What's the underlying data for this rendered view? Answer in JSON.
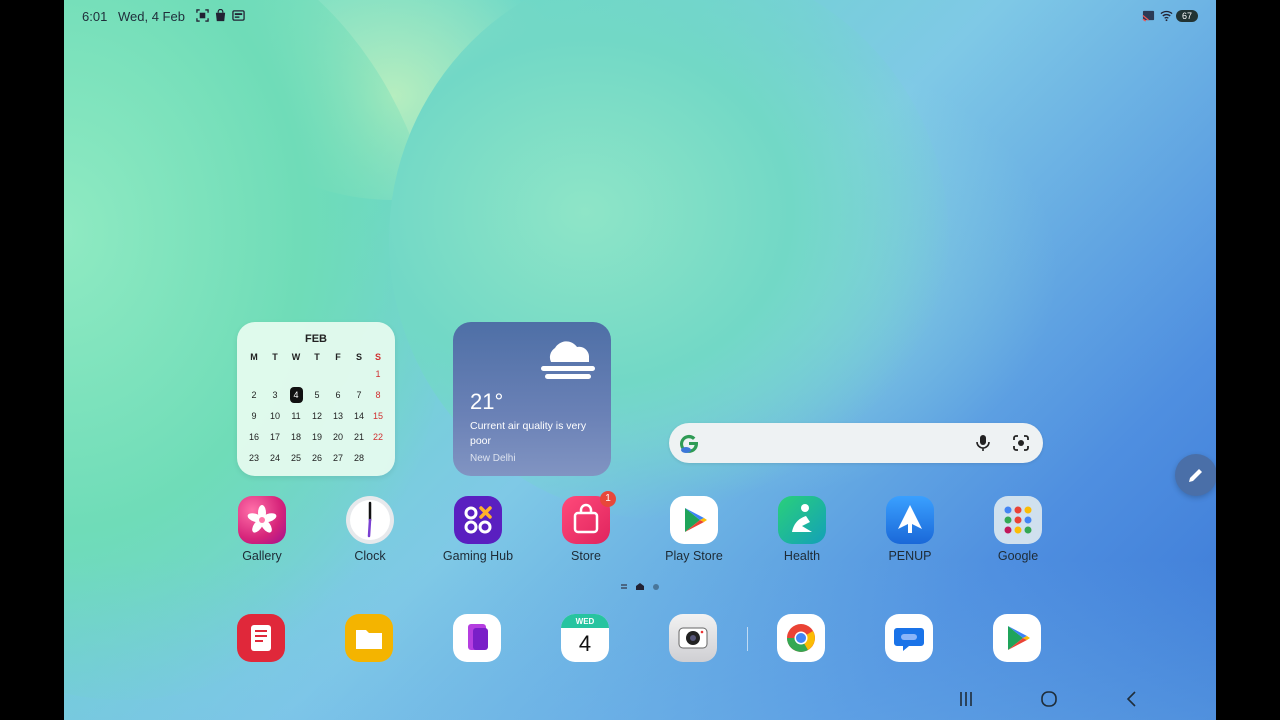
{
  "status_bar": {
    "time": "6:01",
    "date": "Wed, 4 Feb",
    "battery": "67"
  },
  "calendar": {
    "month": "FEB",
    "weekdays": [
      "M",
      "T",
      "W",
      "T",
      "F",
      "S",
      "S"
    ],
    "weeks": [
      [
        "",
        "",
        "",
        "",
        "",
        "",
        "1"
      ],
      [
        "2",
        "3",
        "4",
        "5",
        "6",
        "7",
        "8"
      ],
      [
        "9",
        "10",
        "11",
        "12",
        "13",
        "14",
        "15"
      ],
      [
        "16",
        "17",
        "18",
        "19",
        "20",
        "21",
        "22"
      ],
      [
        "23",
        "24",
        "25",
        "26",
        "27",
        "28",
        ""
      ]
    ],
    "today": "4"
  },
  "weather": {
    "temperature": "21°",
    "description": "Current air quality is very poor",
    "location": "New Delhi",
    "icon": "fog-icon"
  },
  "search": {
    "icons": [
      "google-g-icon",
      "mic-icon",
      "lens-icon"
    ]
  },
  "apps": [
    {
      "label": "Gallery",
      "icon": "gallery-icon"
    },
    {
      "label": "Clock",
      "icon": "clock-icon"
    },
    {
      "label": "Gaming Hub",
      "icon": "gaming-hub-icon"
    },
    {
      "label": "Store",
      "icon": "store-icon",
      "badge": "1"
    },
    {
      "label": "Play Store",
      "icon": "play-store-icon"
    },
    {
      "label": "Health",
      "icon": "health-icon"
    },
    {
      "label": "PENUP",
      "icon": "penup-icon"
    },
    {
      "label": "Google",
      "icon": "google-folder-icon"
    }
  ],
  "dock": [
    {
      "icon": "notes-icon"
    },
    {
      "icon": "my-files-icon"
    },
    {
      "icon": "bookmarks-icon"
    },
    {
      "icon": "calendar-icon",
      "day": "WED",
      "date": "4"
    },
    {
      "icon": "camera-icon"
    },
    {
      "icon": "chrome-icon"
    },
    {
      "icon": "messages-icon"
    },
    {
      "icon": "play-store-icon"
    }
  ],
  "nav": [
    "recents-icon",
    "home-icon",
    "back-icon"
  ],
  "colors": {
    "accent": "#4a6fa8",
    "badge": "#e8473a",
    "sunday": "#d03030"
  }
}
